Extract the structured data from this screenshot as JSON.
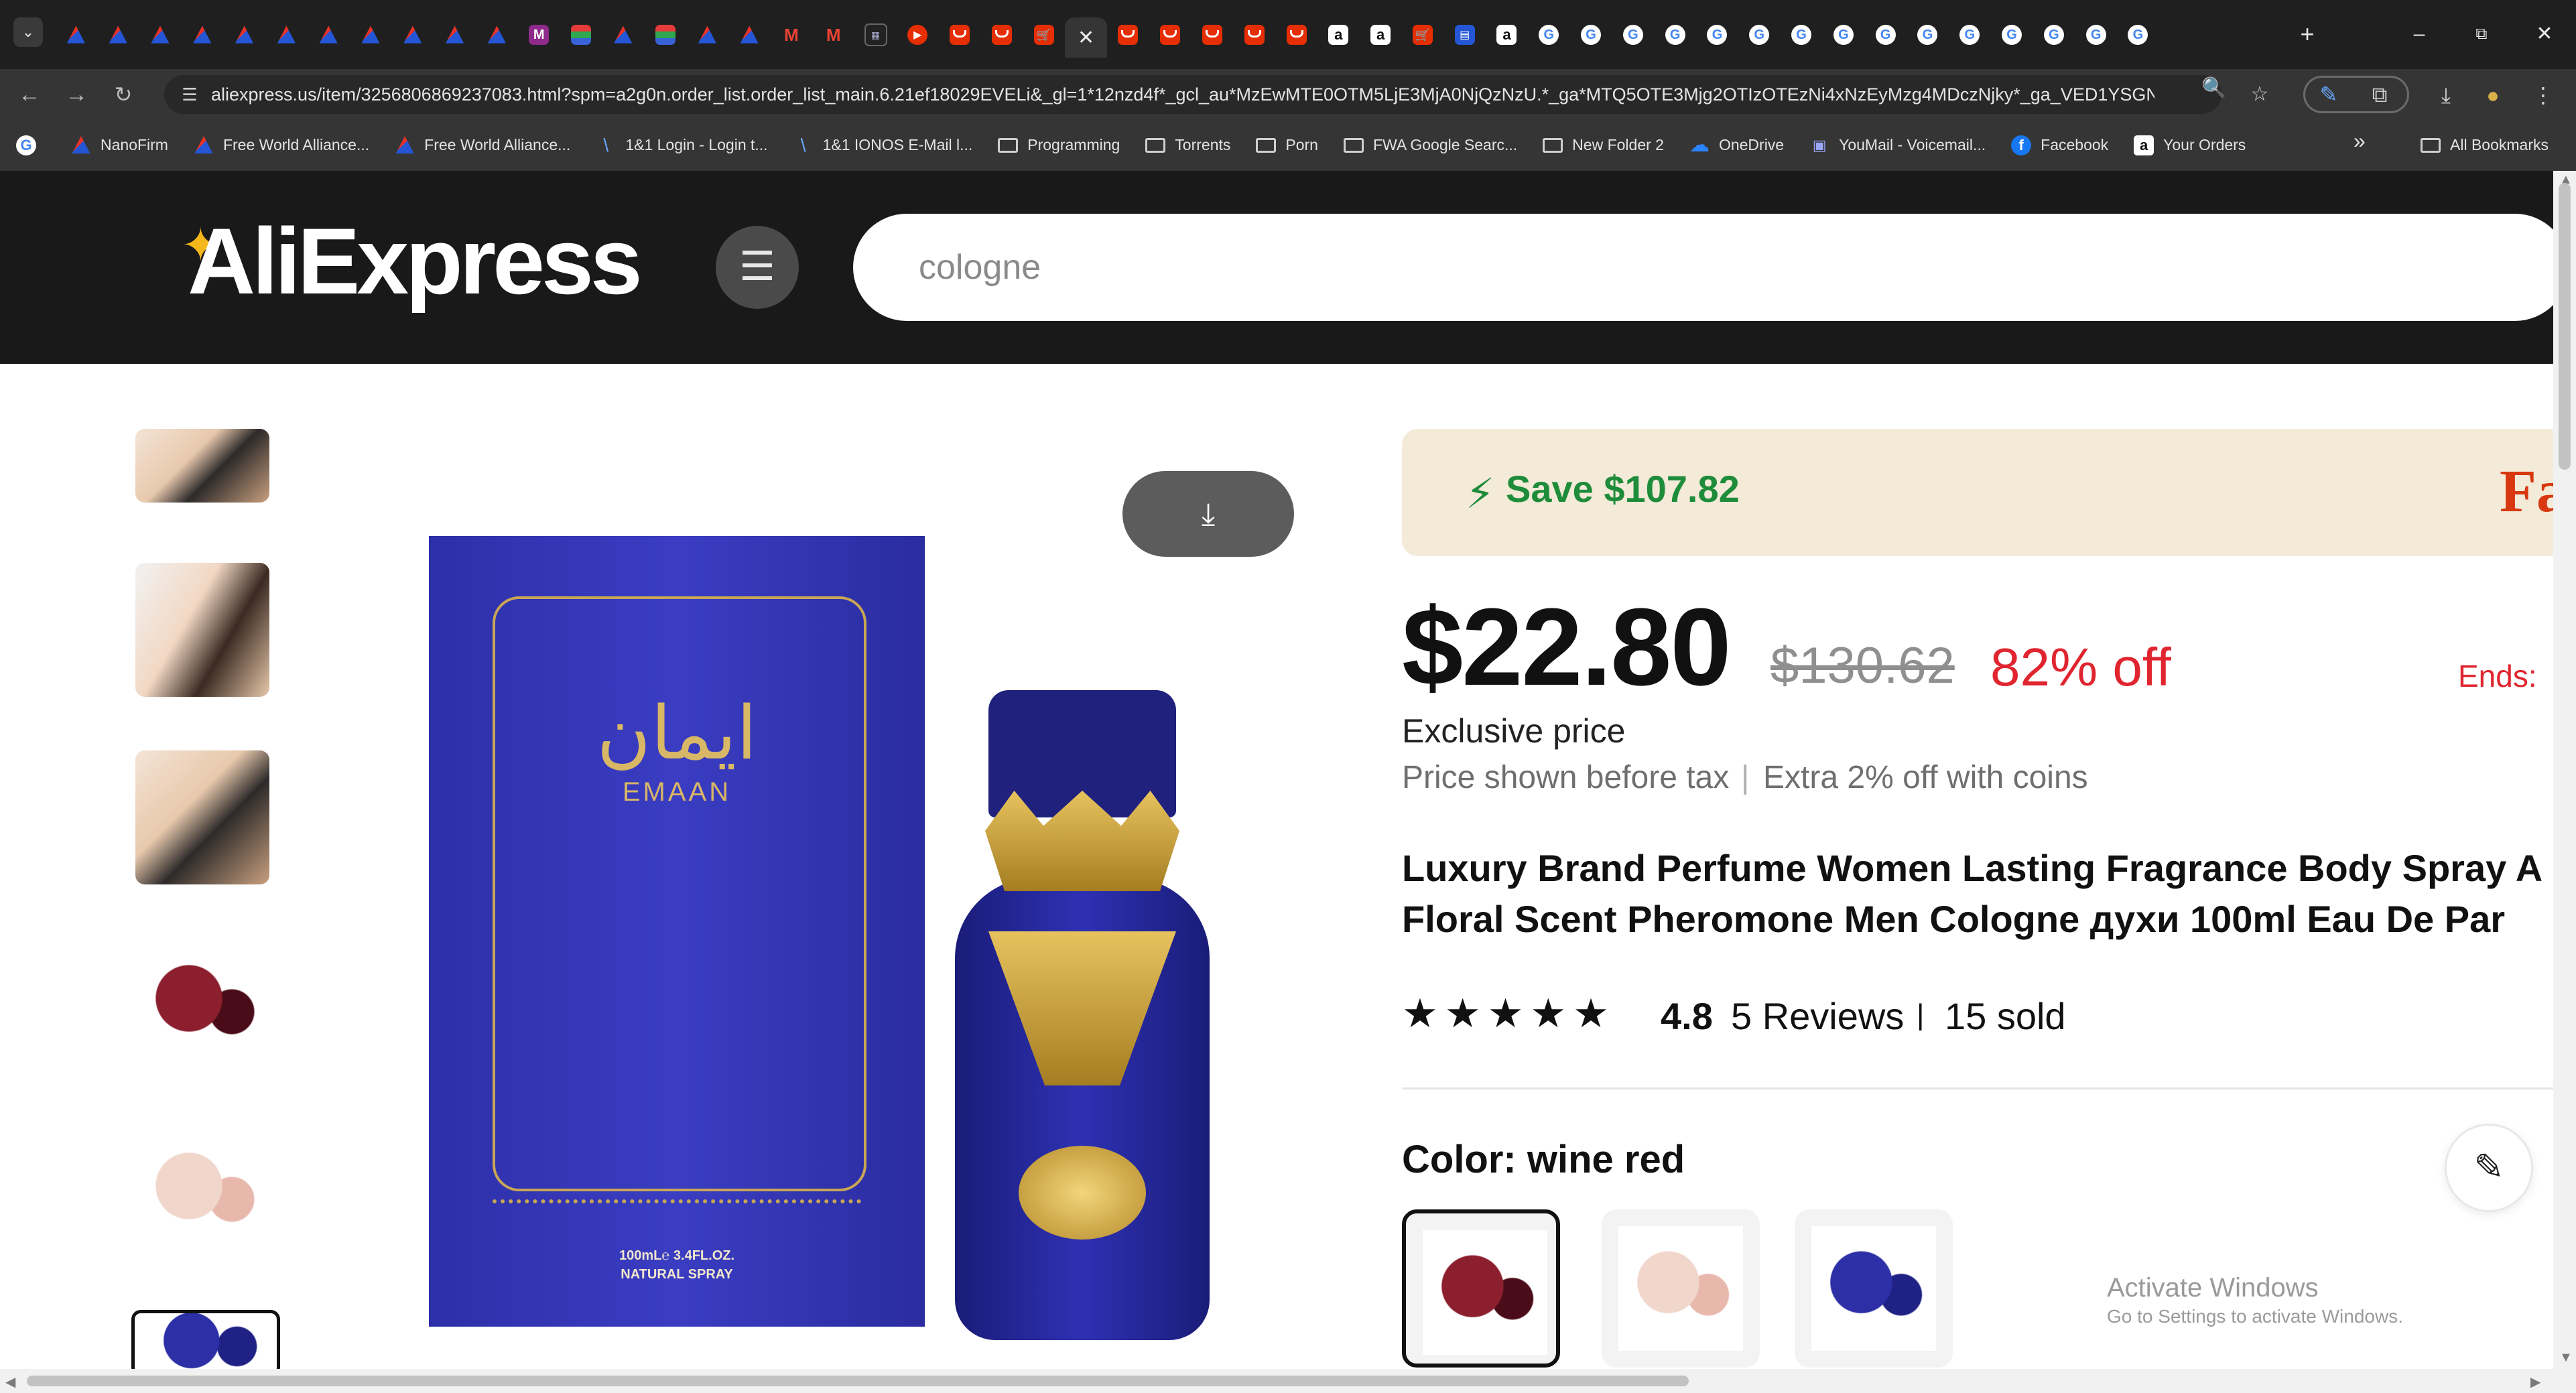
{
  "browser": {
    "tab_favicons": [
      "domino",
      "domino",
      "domino",
      "domino",
      "domino",
      "domino",
      "domino",
      "domino",
      "domino",
      "domino",
      "domino",
      "magazine",
      "flag",
      "domino",
      "flag",
      "domino",
      "domino",
      "gmail",
      "gmail",
      "dark-app",
      "youtube",
      "aliexpress",
      "aliexpress",
      "cart",
      "active",
      "aliexpress",
      "aliexpress",
      "aliexpress",
      "aliexpress",
      "aliexpress",
      "amazon",
      "amazon",
      "cart",
      "blue-app",
      "amazon",
      "google",
      "google",
      "google",
      "google",
      "google",
      "google",
      "google",
      "google",
      "google",
      "google",
      "google",
      "google",
      "google",
      "google",
      "google"
    ],
    "active_tab_close": "✕",
    "new_tab": "+",
    "window_controls": {
      "minimize": "–",
      "restore": "⧉",
      "close": "✕"
    },
    "url": "aliexpress.us/item/3256806869237083.html?spm=a2g0n.order_list.order_list_main.6.21ef18029EVELi&_gl=1*12nzd4f*_gcl_au*MzEwMTE0OTM5LjE3MjA0NjQzNzU.*_ga*MTQ5OTE3Mjg2OTIzOTEzNi4xNzEyMzg4MDczNjky*_ga_VED1YSGNC7...",
    "bookmarks": [
      {
        "label": "",
        "icon": "google"
      },
      {
        "label": "NanoFirm",
        "icon": "domino"
      },
      {
        "label": "Free World Alliance...",
        "icon": "domino"
      },
      {
        "label": "Free World Alliance...",
        "icon": "domino"
      },
      {
        "label": "1&1 Login - Login t...",
        "icon": "ionos"
      },
      {
        "label": "1&1 IONOS E-Mail l...",
        "icon": "ionos"
      },
      {
        "label": "Programming",
        "icon": "folder"
      },
      {
        "label": "Torrents",
        "icon": "folder"
      },
      {
        "label": "Porn",
        "icon": "folder"
      },
      {
        "label": "FWA Google Searc...",
        "icon": "folder"
      },
      {
        "label": "New Folder 2",
        "icon": "folder"
      },
      {
        "label": "OneDrive",
        "icon": "onedrive"
      },
      {
        "label": "YouMail - Voicemail...",
        "icon": "youmail"
      },
      {
        "label": "Facebook",
        "icon": "facebook"
      },
      {
        "label": "Your Orders",
        "icon": "amazon"
      }
    ],
    "bookmarks_more": "»",
    "all_bookmarks": "All Bookmarks"
  },
  "header": {
    "logo": "AliExpress",
    "search_value": "cologne"
  },
  "product": {
    "save_text": "Save $107.82",
    "banner_partial": "Fa",
    "price": "$22.80",
    "original_price": "$130.62",
    "discount": "82% off",
    "ends_label": "Ends:",
    "exclusive_label": "Exclusive price",
    "tax_note": "Price shown before tax",
    "separator": "|",
    "coins_note": "Extra 2% off with coins",
    "title": "Luxury Brand Perfume Women Lasting Fragrance Body Spray Floral Scent Pheromone Men Cologne духи 100ml Eau De Par",
    "title_line1": "Luxury Brand Perfume Women Lasting Fragrance Body Spray A",
    "title_line2": "Floral Scent Pheromone Men Cologne духи 100ml Eau De Par",
    "stars": "★★★★★",
    "rating": "4.8",
    "reviews": "5 Reviews",
    "review_sep": "|",
    "sold": "15 sold",
    "color_label": "Color: wine red",
    "color_options": [
      "wine red",
      "pink",
      "blue"
    ],
    "selected_color_index": 0,
    "image": {
      "arabic_name": "ايمان",
      "brand_name": "EMAAN",
      "spec_line1": "100mL℮ 3.4FL.OZ.",
      "spec_line2": "NATURAL SPRAY"
    }
  },
  "os_watermark": {
    "line1": "Activate Windows",
    "line2": "Go to Settings to activate Windows."
  },
  "colors": {
    "accent_red": "#e0252f",
    "save_green": "#1e8c3a",
    "header_bg": "#191919"
  }
}
